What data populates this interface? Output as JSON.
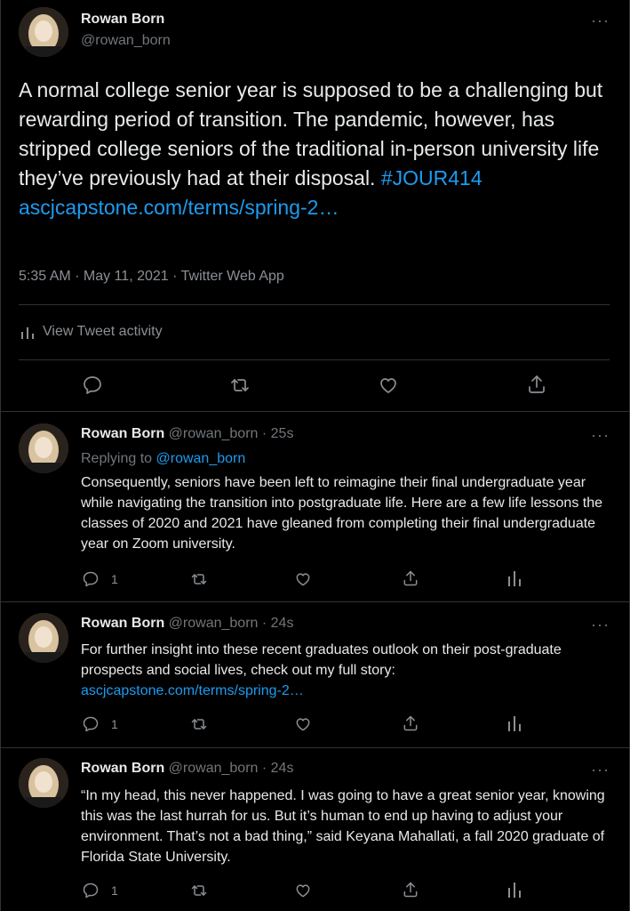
{
  "main_tweet": {
    "author_name": "Rowan Born",
    "author_handle": "@rowan_born",
    "text": "A normal college senior year is supposed to be a challenging but rewarding period of transition. The pandemic, however, has stripped college seniors of the traditional in-person university life they’ve previously had at their disposal. ",
    "hashtag": "#JOUR414",
    "link": "ascjcapstone.com/terms/spring-2…",
    "timestamp": "5:35 AM · May 11, 2021 · Twitter Web App",
    "activity_label": "View Tweet activity",
    "more_icon": "more-dots-icon"
  },
  "replies": [
    {
      "author_name": "Rowan Born",
      "author_handle": "@rowan_born",
      "time": "25s",
      "separator": " · ",
      "replying_prefix": "Replying to ",
      "replying_handle": "@rowan_born",
      "text": "Consequently, seniors have been left to reimagine their final undergraduate year while navigating the transition into postgraduate life. Here are a few life lessons the classes of 2020 and 2021 have gleaned from completing their final undergraduate year on Zoom university.",
      "reply_count": "1"
    },
    {
      "author_name": "Rowan Born",
      "author_handle": "@rowan_born",
      "time": "24s",
      "separator": " · ",
      "text": "For further insight into these recent graduates outlook on their post-graduate prospects and social lives, check out my full story:",
      "link": "ascjcapstone.com/terms/spring-2…",
      "reply_count": "1"
    },
    {
      "author_name": "Rowan Born",
      "author_handle": "@rowan_born",
      "time": "24s",
      "separator": " · ",
      "text": "“In my head, this never happened. I was going to have a great senior year, knowing this was the last hurrah for us. But it’s human to end up having to adjust your environment. That’s not a bad thing,” said Keyana Mahallati, a fall 2020 graduate of Florida State University.",
      "reply_count": "1"
    }
  ],
  "colors": {
    "background": "#000000",
    "text": "#e7e9ea",
    "muted": "#71767b",
    "link": "#1d9bf0",
    "divider": "#2f3336"
  }
}
